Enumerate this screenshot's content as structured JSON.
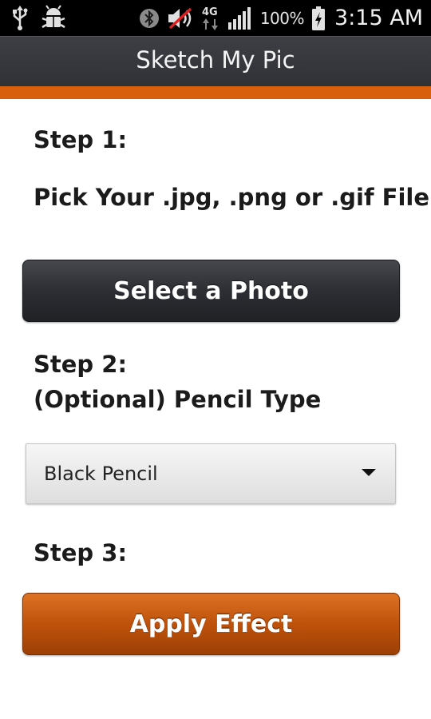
{
  "status_bar": {
    "left_icons": [
      "usb-icon",
      "android-debug-icon"
    ],
    "right_icons": [
      "bluetooth-icon",
      "volume-muted-icon",
      "4g-data-icon",
      "signal-icon",
      "battery-charging-icon"
    ],
    "network_label": "4G",
    "battery_percent": "100%",
    "time": "3:15 AM"
  },
  "app_bar": {
    "title": "Sketch My Pic"
  },
  "colors": {
    "accent": "#d85f0c",
    "app_bar": "#36383d",
    "dark_button": "#2c2e33",
    "orange_button": "#bf520b"
  },
  "step1": {
    "label": "Step 1:",
    "instruction": "Pick Your .jpg, .png or .gif File",
    "button_label": "Select a Photo"
  },
  "step2": {
    "label": "Step 2:",
    "instruction": "(Optional) Pencil Type",
    "selected_pencil": "Black Pencil"
  },
  "step3": {
    "label": "Step 3:",
    "button_label": "Apply Effect"
  }
}
